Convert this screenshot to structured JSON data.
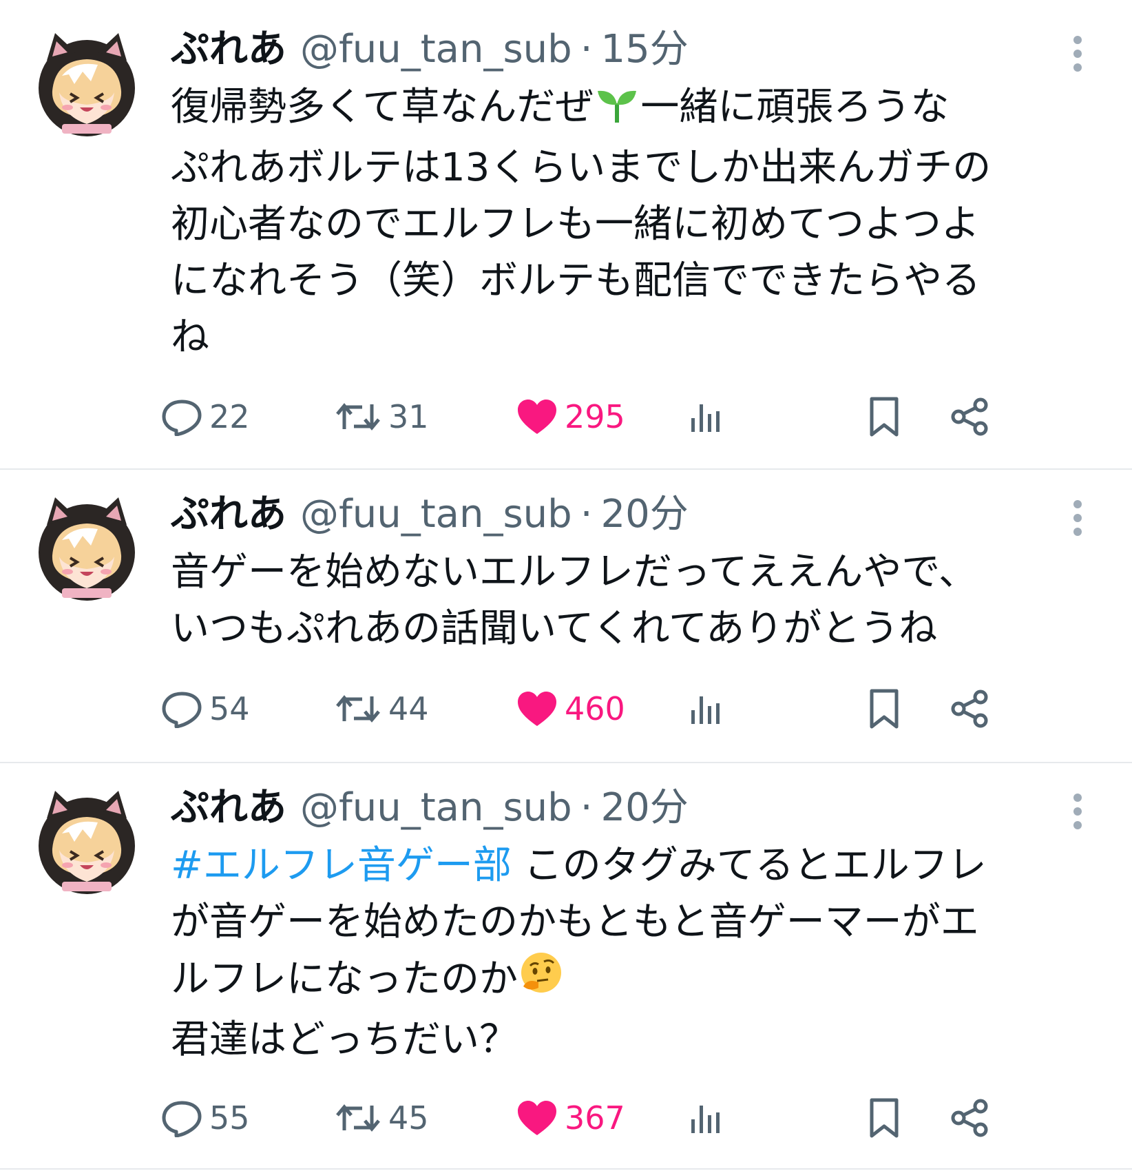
{
  "colors": {
    "text": "#0f1419",
    "muted": "#536471",
    "link": "#1d9bf0",
    "like": "#f91880",
    "divider": "#e6e9ec"
  },
  "icons": [
    "avatar",
    "more-vertical-icon",
    "reply-icon",
    "retweet-icon",
    "heart-icon",
    "views-icon",
    "bookmark-icon",
    "share-icon",
    "seedling-icon",
    "thinking-face-icon"
  ],
  "tweets": [
    {
      "name": "ぷれあ",
      "handle": "@fuu_tan_sub",
      "dot": "·",
      "time": "15分",
      "text_parts": [
        "復帰勢多くて草なんだぜ",
        "一緒に頑張ろうな\nぷれあボルテは13くらいまでしか出来んガチの\n初心者なのでエルフレも一緒に初めてつよつよ\nになれそう（笑）ボルテも配信でできたらやる\nね"
      ],
      "replies": "22",
      "retweets": "31",
      "likes": "295"
    },
    {
      "name": "ぷれあ",
      "handle": "@fuu_tan_sub",
      "dot": "·",
      "time": "20分",
      "text": "音ゲーを始めないエルフレだってええんやで、\nいつもぷれあの話聞いてくれてありがとうね",
      "replies": "54",
      "retweets": "44",
      "likes": "460"
    },
    {
      "name": "ぷれあ",
      "handle": "@fuu_tan_sub",
      "dot": "·",
      "time": "20分",
      "hashtag": "#エルフレ音ゲー部",
      "text_parts": [
        " このタグみてるとエルフレ\nが音ゲーを始めたのかもともと音ゲーマーがエ\nルフレになったのか",
        "\n君達はどっちだい？"
      ],
      "replies": "55",
      "retweets": "45",
      "likes": "367"
    }
  ]
}
